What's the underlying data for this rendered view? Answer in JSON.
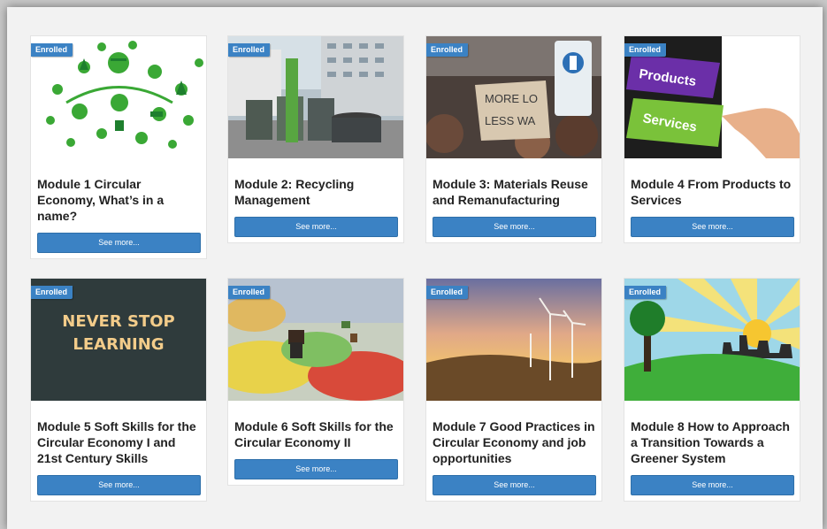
{
  "badge_label": "Enrolled",
  "button_label": "See more...",
  "modules": [
    {
      "title": "Module 1 Circular Economy, What’s in a name?",
      "image": "circular-economy-icons"
    },
    {
      "title": "Module 2: Recycling Management",
      "image": "recycling-bins-photo"
    },
    {
      "title": "Module 3: Materials Reuse and Remanufacturing",
      "image": "protest-sign-photo",
      "sign_text": [
        "MORE LO",
        "LESS WA"
      ]
    },
    {
      "title": "Module 4 From Products to Services",
      "image": "keyboard-keys-photo",
      "keys": [
        "Products",
        "Services"
      ]
    },
    {
      "title": "Module 5 Soft Skills for the Circular Economy I and 21st Century Skills",
      "image": "chalkboard-photo",
      "board_text": [
        "NEVER STOP",
        "LEARNING"
      ]
    },
    {
      "title": "Module 6 Soft Skills for the Circular Economy II",
      "image": "colorful-game-pieces-photo"
    },
    {
      "title": "Module 7 Good Practices in Circular Economy and job opportunities",
      "image": "wind-turbines-photo"
    },
    {
      "title": "Module 8 How to Approach a Transition Towards a Greener System",
      "image": "green-city-illustration"
    }
  ],
  "colors": {
    "accent": "#3b82c4",
    "page_bg": "#f2f2f2"
  }
}
